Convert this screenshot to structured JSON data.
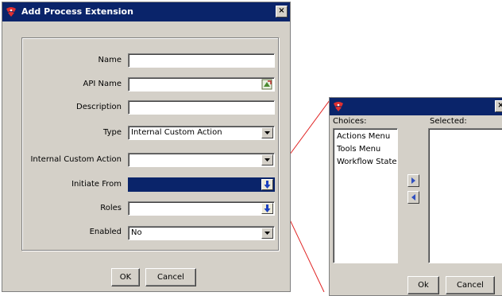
{
  "main_dialog": {
    "title": "Add Process Extension",
    "close_glyph": "×",
    "fields": {
      "name": {
        "label": "Name",
        "value": ""
      },
      "api_name": {
        "label": "API Name",
        "value": ""
      },
      "description": {
        "label": "Description",
        "value": ""
      },
      "type": {
        "label": "Type",
        "value": "Internal Custom Action"
      },
      "internal_custom_action": {
        "label": "Internal Custom Action",
        "value": ""
      },
      "initiate_from": {
        "label": "Initiate From",
        "value": ""
      },
      "roles": {
        "label": "Roles",
        "value": ""
      },
      "enabled": {
        "label": "Enabled",
        "value": "No"
      }
    },
    "ok_label": "OK",
    "cancel_label": "Cancel"
  },
  "chooser_dialog": {
    "close_glyph": "×",
    "choices_label": "Choices:",
    "selected_label": "Selected:",
    "choices": [
      "Actions Menu",
      "Tools Menu",
      "Workflow State"
    ],
    "ok_label": "Ok",
    "cancel_label": "Cancel"
  },
  "colors": {
    "titlebar": "#0a246a",
    "dialog_face": "#d4d0c8",
    "callout_line": "#e02020",
    "selection": "#0a246a"
  },
  "icons": {
    "app": "app-logo-icon",
    "api_name_picker": "lookup-picker-icon",
    "dropdown": "chevron-down-icon",
    "multi_select": "blue-down-arrow-icon",
    "move_right": "arrow-right-icon",
    "move_left": "arrow-left-icon"
  }
}
